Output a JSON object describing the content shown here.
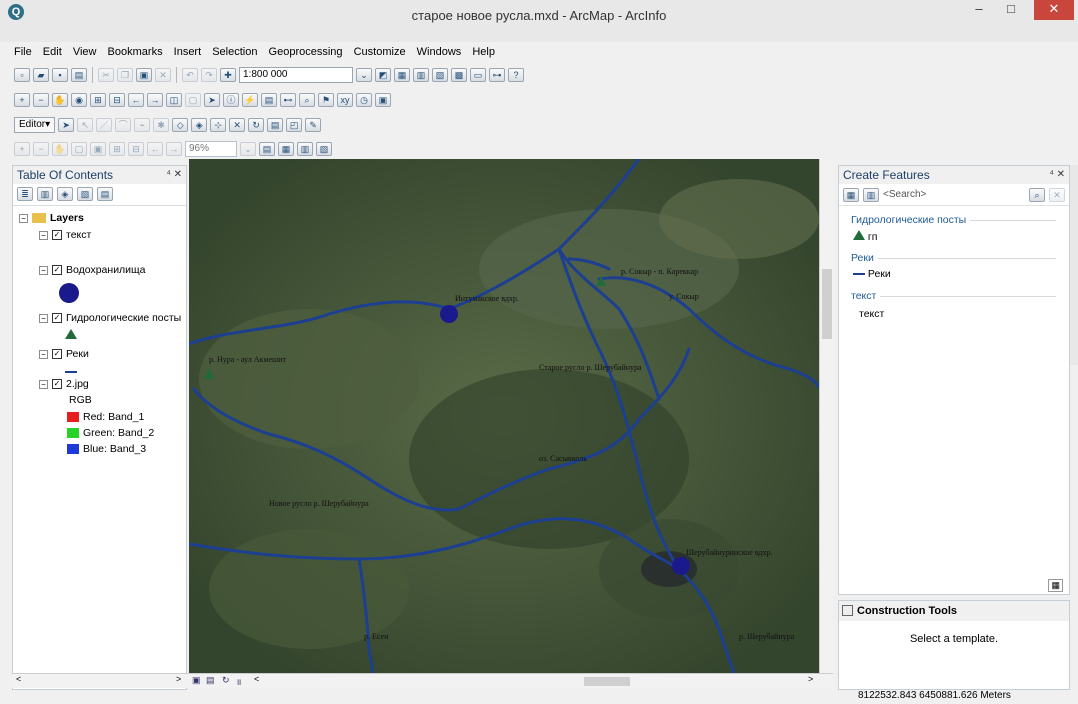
{
  "window": {
    "title": "старое новое русла.mxd - ArcMap - ArcInfo",
    "app_glyph": "Q",
    "minimize": "–",
    "maximize": "□",
    "close": "✕"
  },
  "menu": [
    "File",
    "Edit",
    "View",
    "Bookmarks",
    "Insert",
    "Selection",
    "Geoprocessing",
    "Customize",
    "Windows",
    "Help"
  ],
  "toolbar": {
    "scale": "1:800 000",
    "layout_zoom": "96%",
    "editor_label": "Editor▾"
  },
  "toc": {
    "title": "Table Of Contents",
    "pin": "⁴ ✕",
    "root_label": "Layers",
    "layers": [
      {
        "label": "текст"
      },
      {
        "label": "Водохранилища"
      },
      {
        "label": "Гидрологические посты"
      },
      {
        "label": "Реки"
      },
      {
        "label": "2.jpg",
        "sub": "RGB"
      }
    ],
    "bands": [
      {
        "label": "Red:  Band_1",
        "color": "#e61e1e"
      },
      {
        "label": "Green: Band_2",
        "color": "#27d327"
      },
      {
        "label": "Blue:  Band_3",
        "color": "#1f3ad8"
      }
    ]
  },
  "map": {
    "labels": [
      "р. Сокыр - п. Кареккар",
      "у. Сокыр",
      "Интумакское вдхр.",
      "р. Нура - аул Акмешит",
      "Старое русло р. Шерубайнура",
      "оз. Сасыкколь",
      "Новое русло р. Шерубайнура",
      "Шерубайнуринское вдхр.",
      "р. Есен",
      "р. Шерубайнура"
    ],
    "river_color": "#1c3f91",
    "reservoir_color": "#1a1a8c",
    "post_color": "#1f6b3a"
  },
  "create_features": {
    "title": "Create Features",
    "pin": "⁴ ✕",
    "search_placeholder": "<Search>",
    "groups": [
      {
        "name": "Гидрологические посты",
        "template": "гп"
      },
      {
        "name": "Реки",
        "template": "Реки"
      },
      {
        "name": "текст",
        "template": "текст"
      }
    ]
  },
  "construction_tools": {
    "title": "Construction Tools",
    "message": "Select a template."
  },
  "status": {
    "coordinates": "8122532.843  6450881.626 Meters"
  }
}
